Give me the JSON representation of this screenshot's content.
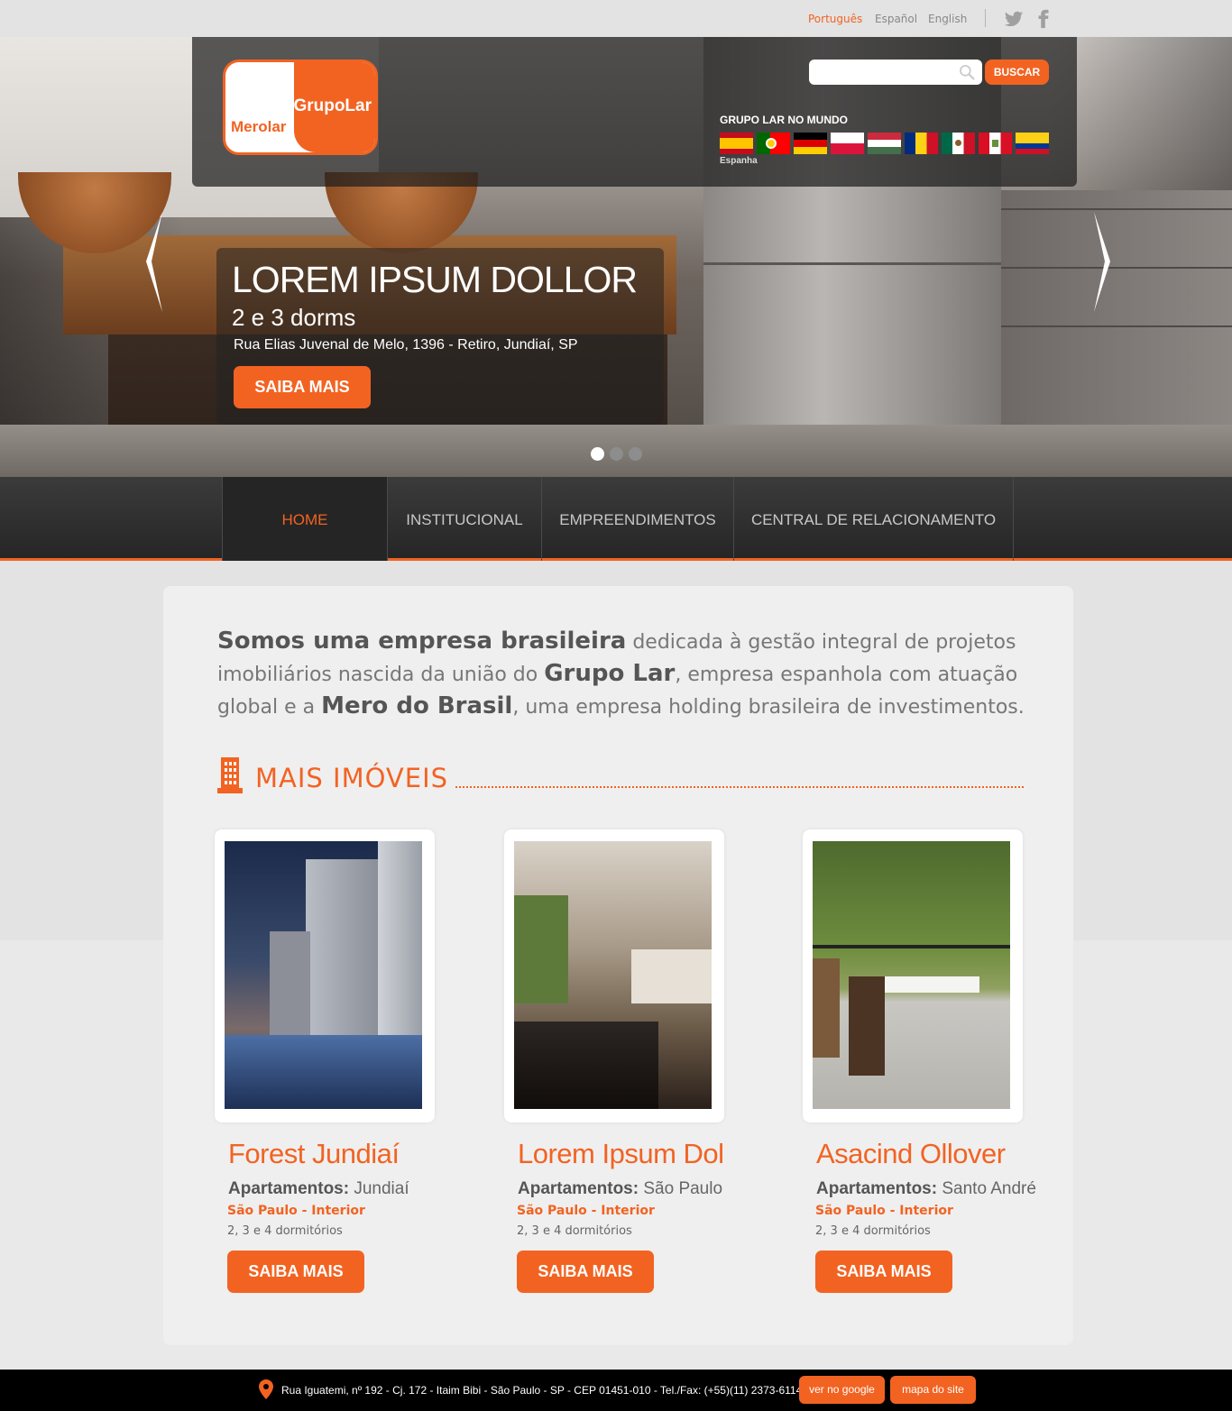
{
  "languages": [
    {
      "label": "Português",
      "active": true
    },
    {
      "label": "Español",
      "active": false
    },
    {
      "label": "English",
      "active": false
    }
  ],
  "social": [
    "twitter-icon",
    "facebook-icon"
  ],
  "logo": {
    "left_text": "Merolar",
    "right_text": "GrupoLar"
  },
  "search": {
    "placeholder": "",
    "button_label": "BUSCAR"
  },
  "world": {
    "title": "GRUPO LAR NO MUNDO",
    "flags": [
      "spain",
      "portugal",
      "germany",
      "poland",
      "hungary",
      "romania",
      "mexico",
      "peru",
      "colombia"
    ],
    "caption": "Espanha"
  },
  "slide": {
    "title": "LOREM IPSUM DOLLOR",
    "subtitle": "2 e 3 dorms",
    "address": "Rua Elias Juvenal de Melo, 1396 - Retiro, Jundiaí, SP",
    "button_label": "SAIBA MAIS",
    "active_dot": 1,
    "dot_count": 3
  },
  "nav": {
    "items": [
      {
        "label": "HOME",
        "active": true
      },
      {
        "label": "INSTITUCIONAL",
        "active": false
      },
      {
        "label": "EMPREENDIMENTOS",
        "active": false
      },
      {
        "label": "CENTRAL DE RELACIONAMENTO",
        "active": false
      }
    ]
  },
  "intro": {
    "p1_bold": "Somos uma empresa brasileira",
    "p1": " dedicada à gestão integral de projetos imobiliários nascida da união do ",
    "p2_bold": "Grupo Lar",
    "p2": ", empresa espanhola com atuação global e a ",
    "p3_bold": "Mero do Brasil",
    "p3": ", uma empresa holding brasileira de investimentos."
  },
  "section": {
    "title": "MAIS IMÓVEIS"
  },
  "cards": [
    {
      "name": "Forest Jundiaí",
      "type_label": "Apartamentos:",
      "city": " Jundiaí",
      "region": "São Paulo - Interior",
      "dorms": "2, 3 e 4 dormitórios",
      "button_label": "SAIBA MAIS"
    },
    {
      "name": "Lorem Ipsum Dol",
      "type_label": "Apartamentos:",
      "city": " São Paulo",
      "region": "São Paulo - Interior",
      "dorms": "2, 3 e 4 dormitórios",
      "button_label": "SAIBA MAIS"
    },
    {
      "name": "Asacind Ollover",
      "type_label": "Apartamentos:",
      "city": " Santo André",
      "region": "São Paulo - Interior",
      "dorms": "2, 3 e 4 dormitórios",
      "button_label": "SAIBA MAIS"
    }
  ],
  "footer": {
    "address": "Rua Iguatemi, nº 192 - Cj. 172 - Itaim Bibi - São Paulo - SP - CEP 01451-010 - Tel./Fax: (+55)(11) 2373-6114",
    "google_label": "ver no google",
    "sitemap_label": "mapa do site"
  },
  "colors": {
    "accent": "#f26322",
    "nav_bg": "#2e2e2e",
    "footer_bg": "#000000"
  }
}
